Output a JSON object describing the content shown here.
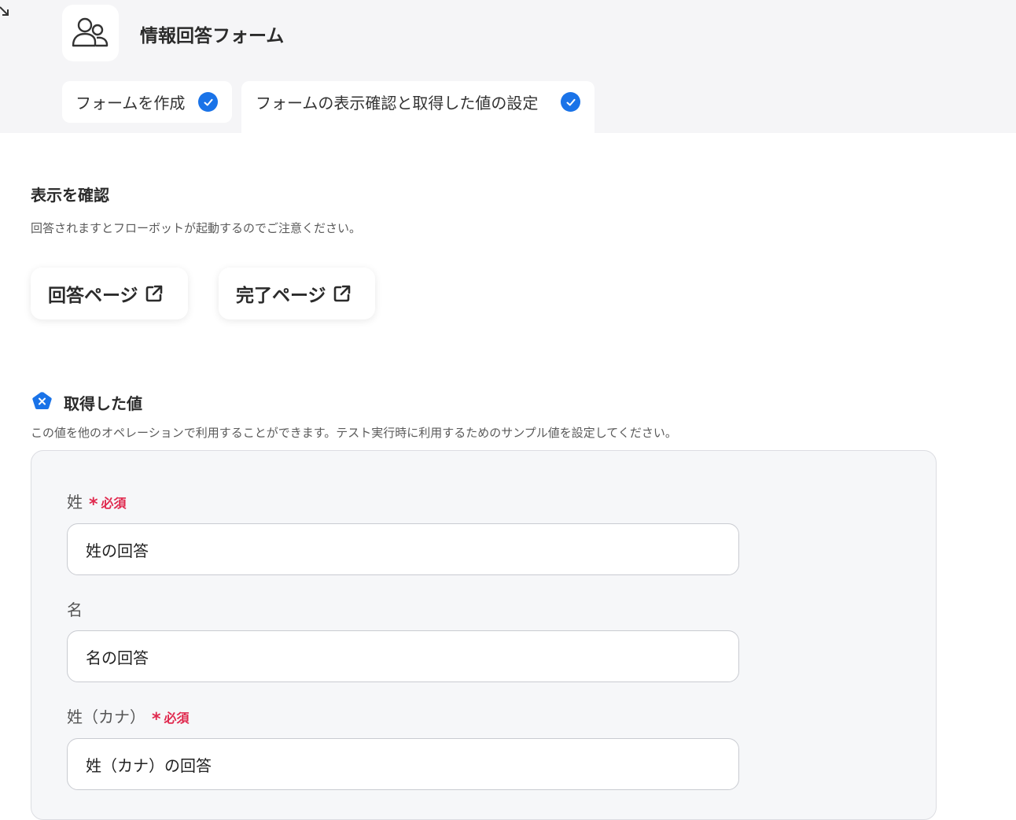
{
  "header": {
    "app_title": "情報回答フォーム",
    "tabs": [
      {
        "label": "フォームを作成",
        "completed": true
      },
      {
        "label": "フォームの表示確認と取得した値の設定",
        "completed": true
      }
    ]
  },
  "display_section": {
    "title": "表示を確認",
    "note": "回答されますとフローボットが起動するのでご注意ください。",
    "buttons": [
      {
        "label": "回答ページ",
        "icon": "external-link-icon"
      },
      {
        "label": "完了ページ",
        "icon": "external-link-icon"
      }
    ]
  },
  "values_section": {
    "title": "取得した値",
    "note": "この値を他のオペレーションで利用することができます。テスト実行時に利用するためのサンプル値を設定してください。",
    "required_label": "必須",
    "fields": [
      {
        "label": "姓",
        "required": true,
        "value": "姓の回答"
      },
      {
        "label": "名",
        "required": false,
        "value": "名の回答"
      },
      {
        "label": "姓（カナ）",
        "required": true,
        "value": "姓（カナ）の回答"
      }
    ]
  },
  "colors": {
    "accent": "#1a73e8",
    "required": "#e0294e",
    "header_bg": "#f5f5f7",
    "panel_bg": "#f6f7f9"
  }
}
